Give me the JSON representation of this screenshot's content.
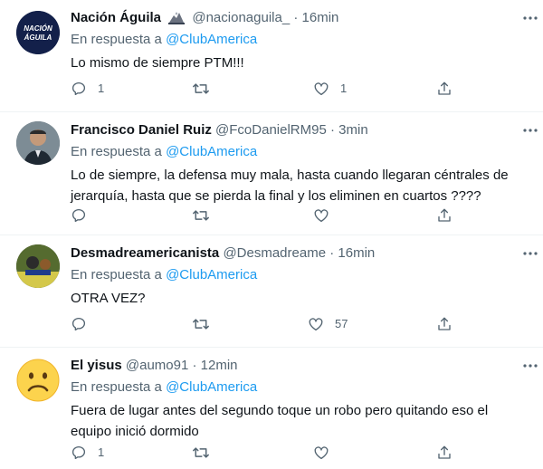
{
  "tweets": [
    {
      "name": "Nación Águila",
      "handle": "@nacionaguila_",
      "time": "16min",
      "reply_prefix": "En respuesta a",
      "reply_to": "@ClubAmerica",
      "text": "Lo mismo de siempre PTM!!!",
      "replies": "1",
      "retweets": "",
      "likes": "1",
      "avatar_text": "NACIÓN ÁGUILA"
    },
    {
      "name": "Francisco Daniel Ruiz",
      "handle": "@FcoDanielRM95",
      "time": "3min",
      "reply_prefix": "En respuesta a",
      "reply_to": "@ClubAmerica",
      "text": "Lo de siempre, la defensa muy mala, hasta cuando llegaran céntrales de jerarquía, hasta que se pierda la final y los eliminen en cuartos ????",
      "replies": "",
      "retweets": "",
      "likes": ""
    },
    {
      "name": "Desmadreamericanista",
      "handle": "@Desmadreame",
      "time": "16min",
      "reply_prefix": "En respuesta a",
      "reply_to": "@ClubAmerica",
      "text": "OTRA VEZ?",
      "replies": "",
      "retweets": "",
      "likes": "57"
    },
    {
      "name": "El yisus",
      "handle": "@aumo91",
      "time": "12min",
      "reply_prefix": "En respuesta a",
      "reply_to": "@ClubAmerica",
      "text": "Fuera de lugar antes del segundo toque un robo pero quitando eso el equipo inició dormido",
      "replies": "1",
      "retweets": "",
      "likes": ""
    }
  ],
  "separator": "·",
  "icons": [
    "reply-icon",
    "retweet-icon",
    "like-icon",
    "share-icon",
    "more-icon"
  ],
  "colors": {
    "text": "#0f1419",
    "muted": "#536471",
    "link": "#1d9bf0",
    "border": "#eff3f4"
  }
}
